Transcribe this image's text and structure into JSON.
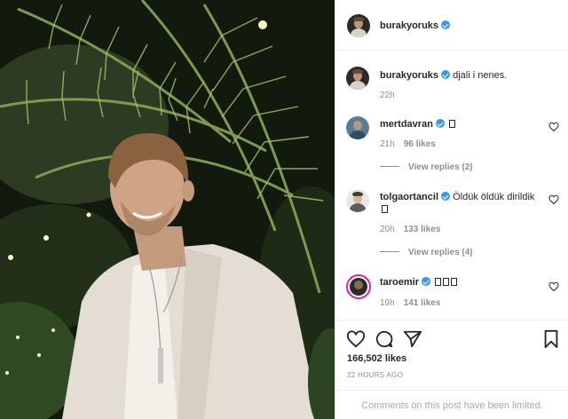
{
  "post": {
    "author": "burakyoruks",
    "verified": true
  },
  "caption": {
    "username": "burakyoruks",
    "text": "djali i nenes.",
    "time": "22h"
  },
  "comments": [
    {
      "username": "mertdavran",
      "text": "",
      "emoji_count": 1,
      "time": "21h",
      "likes": "96 likes",
      "replies": "View replies (2)"
    },
    {
      "username": "tolgaortancil",
      "text": "Öldük öldük dirildik",
      "emoji_count": 1,
      "time": "20h",
      "likes": "133 likes",
      "replies": "View replies (4)"
    },
    {
      "username": "taroemir",
      "text": "",
      "emoji_count": 3,
      "time": "19h",
      "likes": "141 likes",
      "replies": ""
    }
  ],
  "actions": {
    "icons": [
      "heart-icon",
      "comment-icon",
      "share-icon",
      "bookmark-icon"
    ],
    "likes": "166,502 likes",
    "time_ago": "22 HOURS AGO",
    "comments_notice": "Comments on this post have been limited."
  },
  "colors": {
    "verified": "#3897f0",
    "muted": "#8e8e8e",
    "text": "#262626",
    "border": "#efefef"
  }
}
